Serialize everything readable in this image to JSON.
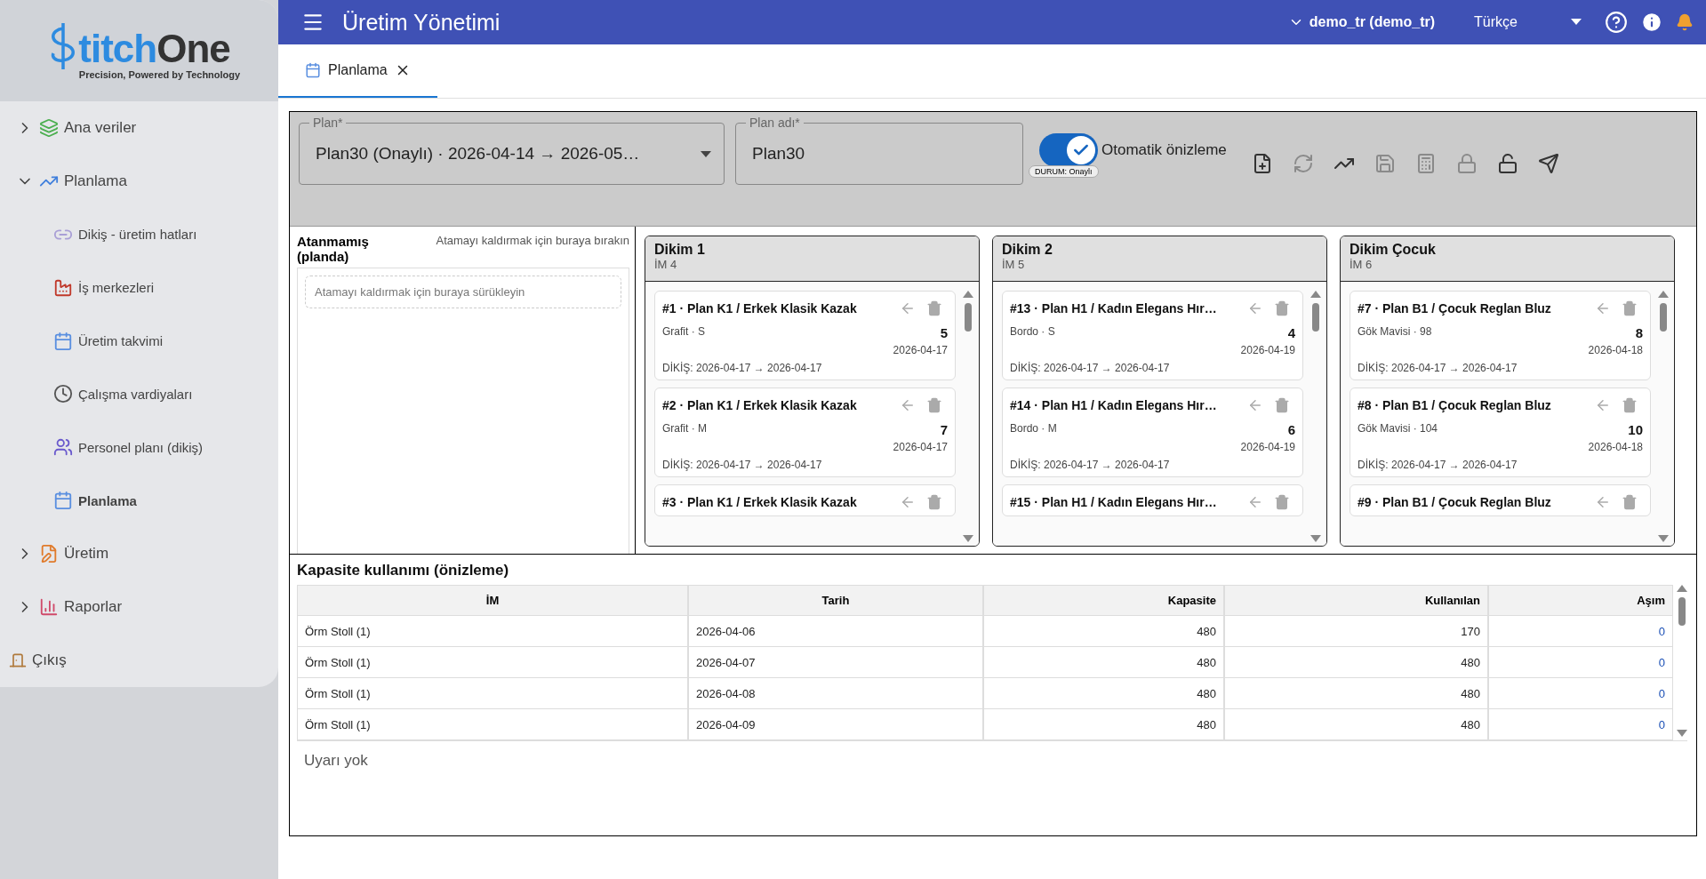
{
  "brand": {
    "name_part_1": "titch",
    "name_part_2": "One",
    "tagline": "Precision, Powered by Technology"
  },
  "sidebar": {
    "items": [
      {
        "label": "Ana veriler",
        "kind": "data",
        "expanded": false,
        "selected": false
      },
      {
        "label": "Planlama",
        "kind": "chart",
        "expanded": true,
        "selected": false,
        "children": [
          {
            "label": "Dikiş - üretim hatları",
            "kind": "link",
            "selected": false
          },
          {
            "label": "İş merkezleri",
            "kind": "factory",
            "selected": false
          },
          {
            "label": "Üretim takvimi",
            "kind": "calendar",
            "selected": false
          },
          {
            "label": "Çalışma vardiyaları",
            "kind": "clock",
            "selected": false
          },
          {
            "label": "Personel planı (dikiş)",
            "kind": "people",
            "selected": false
          },
          {
            "label": "Planlama",
            "kind": "calendar",
            "selected": true
          }
        ]
      },
      {
        "label": "Üretim",
        "kind": "note",
        "expanded": false,
        "selected": false
      },
      {
        "label": "Raporlar",
        "kind": "bars",
        "expanded": false,
        "selected": false
      }
    ],
    "logout": "Çıkış"
  },
  "topbar": {
    "title": "Üretim Yönetimi",
    "user": "demo_tr (demo_tr)",
    "language": "Türkçe"
  },
  "tabs": [
    {
      "label": "Planlama",
      "selected": true
    }
  ],
  "toolbar": {
    "plan": {
      "label": "Plan*",
      "value": "Plan30 (Onaylı) · 2026-04-14 → 2026-05…"
    },
    "plan_name": {
      "label": "Plan adı*",
      "value": "Plan30"
    },
    "auto_preview": {
      "label": "Otomatik önizleme",
      "on": true
    },
    "status": "DURUM: Onaylı",
    "actions": [
      {
        "kind": "new",
        "disabled": false
      },
      {
        "kind": "refresh",
        "disabled": true
      },
      {
        "kind": "trend",
        "disabled": false
      },
      {
        "kind": "save",
        "disabled": true
      },
      {
        "kind": "calculate",
        "disabled": true
      },
      {
        "kind": "lock",
        "disabled": true
      },
      {
        "kind": "unlock",
        "disabled": false
      },
      {
        "kind": "send",
        "disabled": false
      }
    ]
  },
  "unassigned": {
    "title": "Atanmamış (planda)",
    "hint": "Atamayı kaldırmak için buraya bırakın",
    "drop_zone": "Atamayı kaldırmak için buraya sürükleyin"
  },
  "lanes": [
    {
      "name": "Dikim 1",
      "center": "İM 4",
      "cards": [
        {
          "title": "#1 · Plan K1 / Erkek Klasik Kazak",
          "variant": "Grafit · S",
          "qty": "5",
          "date": "2026-04-17",
          "sewing": "DİKİŞ: 2026-04-17 → 2026-04-17"
        },
        {
          "title": "#2 · Plan K1 / Erkek Klasik Kazak",
          "variant": "Grafit · M",
          "qty": "7",
          "date": "2026-04-17",
          "sewing": "DİKİŞ: 2026-04-17 → 2026-04-17"
        },
        {
          "title": "#3 · Plan K1 / Erkek Klasik Kazak"
        }
      ]
    },
    {
      "name": "Dikim 2",
      "center": "İM 5",
      "cards": [
        {
          "title": "#13 · Plan H1 / Kadın Elegans Hır…",
          "variant": "Bordo · S",
          "qty": "4",
          "date": "2026-04-19",
          "sewing": "DİKİŞ: 2026-04-17 → 2026-04-17"
        },
        {
          "title": "#14 · Plan H1 / Kadın Elegans Hır…",
          "variant": "Bordo · M",
          "qty": "6",
          "date": "2026-04-19",
          "sewing": "DİKİŞ: 2026-04-17 → 2026-04-17"
        },
        {
          "title": "#15 · Plan H1 / Kadın Elegans Hır…"
        }
      ]
    },
    {
      "name": "Dikim Çocuk",
      "center": "İM 6",
      "cards": [
        {
          "title": "#7 · Plan B1 / Çocuk Reglan Bluz",
          "variant": "Gök Mavisi · 98",
          "qty": "8",
          "date": "2026-04-18",
          "sewing": "DİKİŞ: 2026-04-17 → 2026-04-17"
        },
        {
          "title": "#8 · Plan B1 / Çocuk Reglan Bluz",
          "variant": "Gök Mavisi · 104",
          "qty": "10",
          "date": "2026-04-18",
          "sewing": "DİKİŞ: 2026-04-17 → 2026-04-17"
        },
        {
          "title": "#9 · Plan B1 / Çocuk Reglan Bluz"
        }
      ]
    }
  ],
  "capacity": {
    "title": "Kapasite kullanımı (önizleme)",
    "columns": [
      "İM",
      "Tarih",
      "Kapasite",
      "Kullanılan",
      "Aşım"
    ],
    "rows": [
      {
        "cells": [
          "Örm Stoll (1)",
          "2026-04-06",
          "480",
          "170",
          "0"
        ]
      },
      {
        "cells": [
          "Örm Stoll (1)",
          "2026-04-07",
          "480",
          "480",
          "0"
        ]
      },
      {
        "cells": [
          "Örm Stoll (1)",
          "2026-04-08",
          "480",
          "480",
          "0"
        ]
      },
      {
        "cells": [
          "Örm Stoll (1)",
          "2026-04-09",
          "480",
          "480",
          "0"
        ]
      }
    ]
  },
  "warnings": "Uyarı yok"
}
